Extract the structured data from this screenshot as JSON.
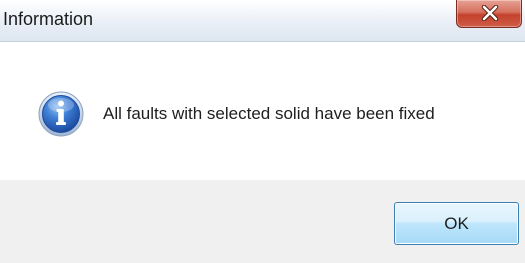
{
  "window": {
    "title": "Information",
    "close_icon": "close-x-icon"
  },
  "message": {
    "icon": "information-icon",
    "text": "All faults with selected solid have been fixed"
  },
  "buttons": {
    "ok_label": "OK"
  }
}
